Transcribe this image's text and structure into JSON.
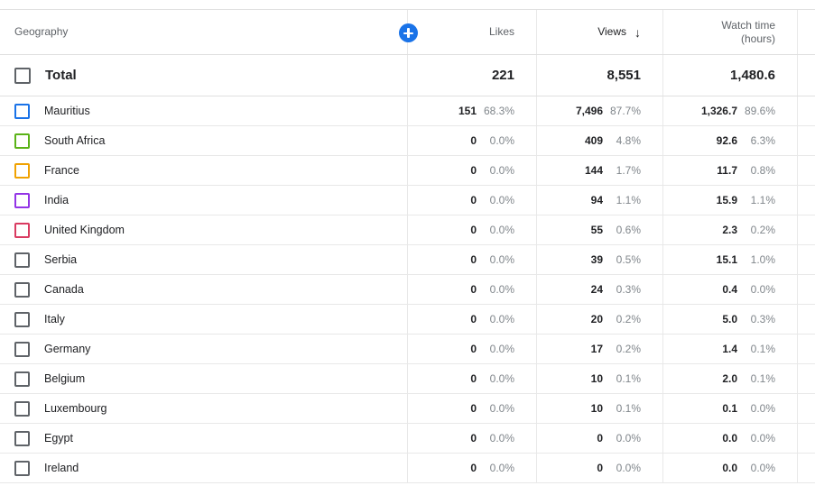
{
  "table": {
    "columns": [
      {
        "key": "geography",
        "label": "Geography",
        "align": "left",
        "active": false
      },
      {
        "key": "likes",
        "label": "Likes",
        "align": "right",
        "active": false
      },
      {
        "key": "views",
        "label": "Views",
        "align": "right",
        "active": true,
        "sort": "descending",
        "sort_icon": "arrow-down-icon"
      },
      {
        "key": "watch_time",
        "label": "Watch time\n(hours)",
        "align": "right",
        "active": false
      }
    ],
    "add_metric_button": {
      "icon": "plus-icon",
      "label": ""
    },
    "total": {
      "label": "Total",
      "likes": "221",
      "views": "8,551",
      "watch_time": "1,480.6",
      "checkbox_color": "#5f6368"
    },
    "rows": [
      {
        "name": "Mauritius",
        "checkbox_color": "#1a73e8",
        "likes": "151",
        "likes_pct": "68.3%",
        "views": "7,496",
        "views_pct": "87.7%",
        "watch_time": "1,326.7",
        "watch_time_pct": "89.6%"
      },
      {
        "name": "South Africa",
        "checkbox_color": "#5bb318",
        "likes": "0",
        "likes_pct": "0.0%",
        "views": "409",
        "views_pct": "4.8%",
        "watch_time": "92.6",
        "watch_time_pct": "6.3%"
      },
      {
        "name": "France",
        "checkbox_color": "#f0a202",
        "likes": "0",
        "likes_pct": "0.0%",
        "views": "144",
        "views_pct": "1.7%",
        "watch_time": "11.7",
        "watch_time_pct": "0.8%"
      },
      {
        "name": "India",
        "checkbox_color": "#9334e6",
        "likes": "0",
        "likes_pct": "0.0%",
        "views": "94",
        "views_pct": "1.1%",
        "watch_time": "15.9",
        "watch_time_pct": "1.1%"
      },
      {
        "name": "United Kingdom",
        "checkbox_color": "#d93b61",
        "likes": "0",
        "likes_pct": "0.0%",
        "views": "55",
        "views_pct": "0.6%",
        "watch_time": "2.3",
        "watch_time_pct": "0.2%"
      },
      {
        "name": "Serbia",
        "checkbox_color": "#5f6368",
        "likes": "0",
        "likes_pct": "0.0%",
        "views": "39",
        "views_pct": "0.5%",
        "watch_time": "15.1",
        "watch_time_pct": "1.0%"
      },
      {
        "name": "Canada",
        "checkbox_color": "#5f6368",
        "likes": "0",
        "likes_pct": "0.0%",
        "views": "24",
        "views_pct": "0.3%",
        "watch_time": "0.4",
        "watch_time_pct": "0.0%"
      },
      {
        "name": "Italy",
        "checkbox_color": "#5f6368",
        "likes": "0",
        "likes_pct": "0.0%",
        "views": "20",
        "views_pct": "0.2%",
        "watch_time": "5.0",
        "watch_time_pct": "0.3%"
      },
      {
        "name": "Germany",
        "checkbox_color": "#5f6368",
        "likes": "0",
        "likes_pct": "0.0%",
        "views": "17",
        "views_pct": "0.2%",
        "watch_time": "1.4",
        "watch_time_pct": "0.1%"
      },
      {
        "name": "Belgium",
        "checkbox_color": "#5f6368",
        "likes": "0",
        "likes_pct": "0.0%",
        "views": "10",
        "views_pct": "0.1%",
        "watch_time": "2.0",
        "watch_time_pct": "0.1%"
      },
      {
        "name": "Luxembourg",
        "checkbox_color": "#5f6368",
        "likes": "0",
        "likes_pct": "0.0%",
        "views": "10",
        "views_pct": "0.1%",
        "watch_time": "0.1",
        "watch_time_pct": "0.0%"
      },
      {
        "name": "Egypt",
        "checkbox_color": "#5f6368",
        "likes": "0",
        "likes_pct": "0.0%",
        "views": "0",
        "views_pct": "0.0%",
        "watch_time": "0.0",
        "watch_time_pct": "0.0%"
      },
      {
        "name": "Ireland",
        "checkbox_color": "#5f6368",
        "likes": "0",
        "likes_pct": "0.0%",
        "views": "0",
        "views_pct": "0.0%",
        "watch_time": "0.0",
        "watch_time_pct": "0.0%"
      }
    ]
  },
  "colors": {
    "accent": "#1a73e8",
    "text_primary": "#202124",
    "text_secondary": "#5f6368",
    "text_muted": "#80868b",
    "border": "#e8e8e8"
  }
}
